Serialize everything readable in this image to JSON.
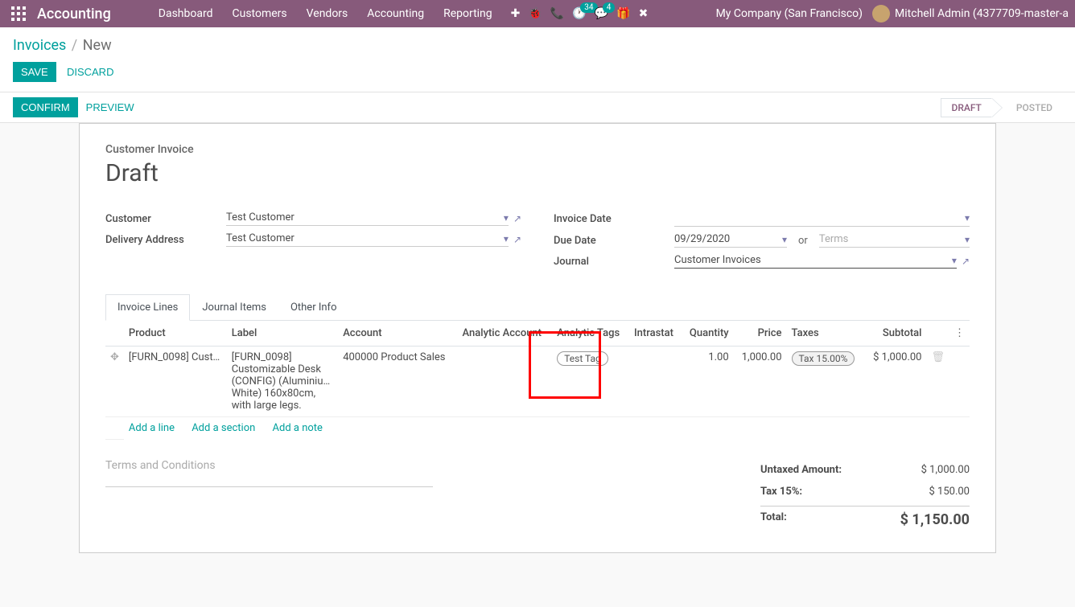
{
  "nav": {
    "brand": "Accounting",
    "links": [
      "Dashboard",
      "Customers",
      "Vendors",
      "Accounting",
      "Reporting"
    ],
    "activity_badge": "34",
    "msg_badge": "4",
    "company": "My Company (San Francisco)",
    "user": "Mitchell Admin (4377709-master-a"
  },
  "breadcrumb": {
    "root": "Invoices",
    "current": "New"
  },
  "buttons": {
    "save": "Save",
    "discard": "Discard",
    "confirm": "Confirm",
    "preview": "Preview"
  },
  "status": {
    "draft": "DRAFT",
    "posted": "POSTED"
  },
  "form": {
    "title": "Customer Invoice",
    "state": "Draft",
    "customer_label": "Customer",
    "customer": "Test Customer",
    "delivery_label": "Delivery Address",
    "delivery": "Test Customer",
    "invoice_date_label": "Invoice Date",
    "due_date_label": "Due Date",
    "due_date": "09/29/2020",
    "or": "or",
    "terms_placeholder": "Terms",
    "journal_label": "Journal",
    "journal": "Customer Invoices"
  },
  "tabs": [
    "Invoice Lines",
    "Journal Items",
    "Other Info"
  ],
  "tableHead": {
    "product": "Product",
    "label": "Label",
    "account": "Account",
    "analytic_account": "Analytic Account",
    "analytic_tags": "Analytic Tags",
    "intrastat": "Intrastat",
    "quantity": "Quantity",
    "price": "Price",
    "taxes": "Taxes",
    "subtotal": "Subtotal"
  },
  "line": {
    "product": "[FURN_0098] Custo…",
    "label": "[FURN_0098] Customizable Desk (CONFIG) (Aluminiu… White) 160x80cm, with large legs.",
    "account": "400000 Product Sales",
    "analytic_tag": "Test Tag",
    "quantity": "1.00",
    "price": "1,000.00",
    "tax": "Tax 15.00%",
    "subtotal": "$ 1,000.00"
  },
  "addLinks": {
    "line": "Add a line",
    "section": "Add a section",
    "note": "Add a note"
  },
  "terms_conditions_placeholder": "Terms and Conditions",
  "totals": {
    "untaxed_label": "Untaxed Amount:",
    "untaxed": "$ 1,000.00",
    "tax_label": "Tax 15%:",
    "tax": "$ 150.00",
    "total_label": "Total:",
    "total": "$ 1,150.00"
  }
}
